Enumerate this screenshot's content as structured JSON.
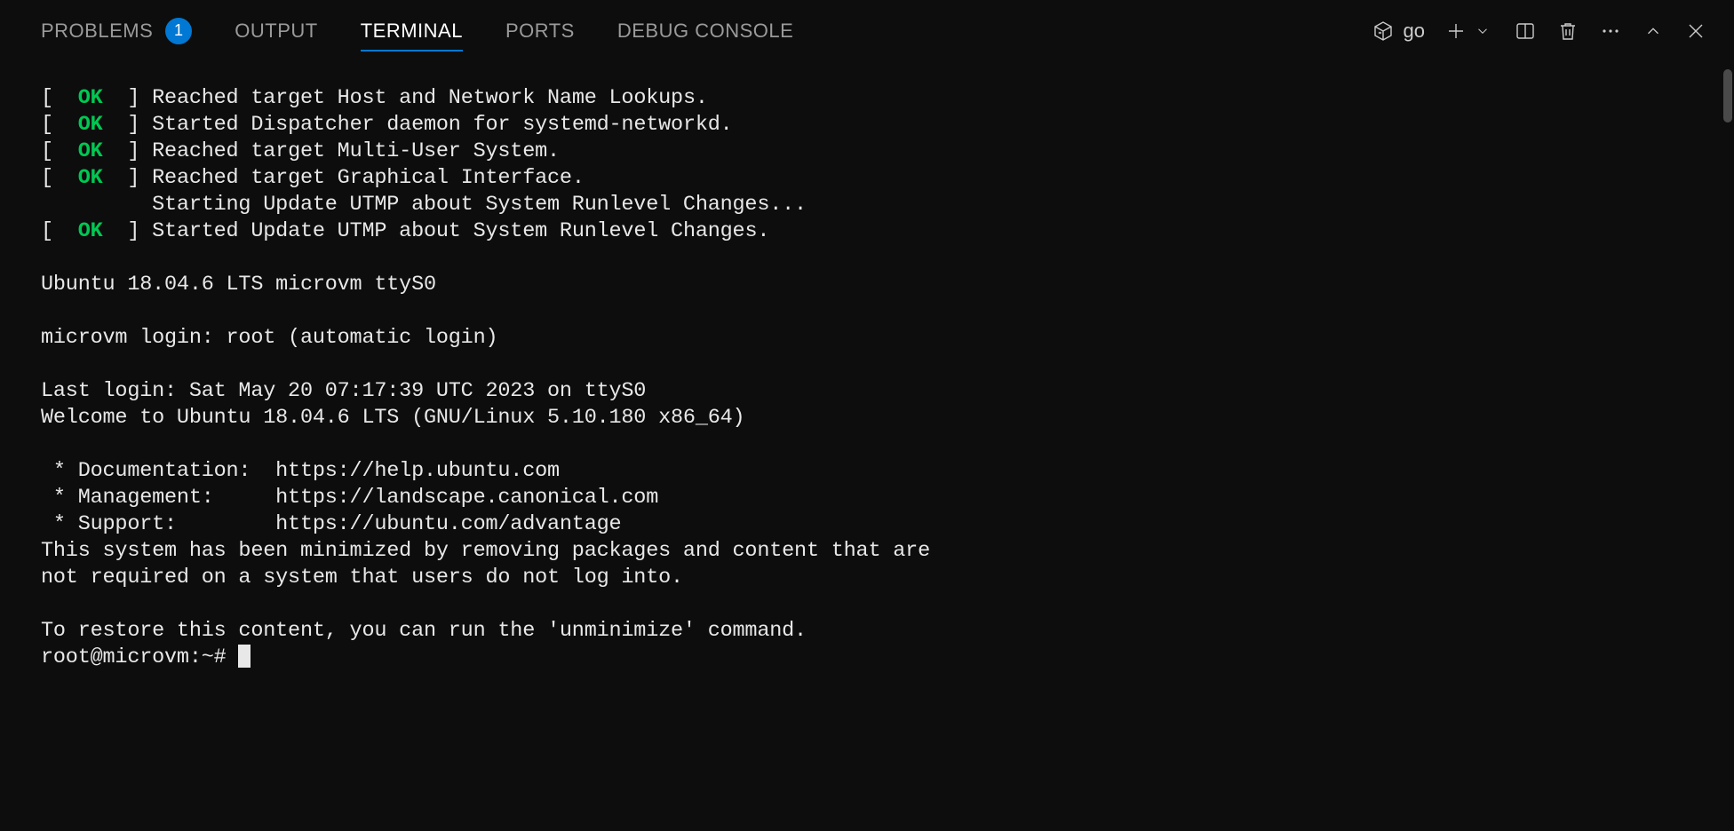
{
  "tabs": {
    "problems": {
      "label": "PROBLEMS",
      "badge": "1"
    },
    "output": {
      "label": "OUTPUT"
    },
    "terminal": {
      "label": "TERMINAL"
    },
    "ports": {
      "label": "PORTS"
    },
    "debug_console": {
      "label": "DEBUG CONSOLE"
    }
  },
  "toolbar": {
    "profile_label": "go"
  },
  "terminal": {
    "boot_lines": [
      {
        "status": "OK",
        "msg": "Reached target Host and Network Name Lookups."
      },
      {
        "status": "OK",
        "msg": "Started Dispatcher daemon for systemd-networkd."
      },
      {
        "status": "OK",
        "msg": "Reached target Multi-User System."
      },
      {
        "status": "OK",
        "msg": "Reached target Graphical Interface."
      },
      {
        "status": "",
        "msg": "Starting Update UTMP about System Runlevel Changes..."
      },
      {
        "status": "OK",
        "msg": "Started Update UTMP about System Runlevel Changes."
      }
    ],
    "banner": "Ubuntu 18.04.6 LTS microvm ttyS0",
    "login_line": "microvm login: root (automatic login)",
    "last_login": "Last login: Sat May 20 07:17:39 UTC 2023 on ttyS0",
    "welcome": "Welcome to Ubuntu 18.04.6 LTS (GNU/Linux 5.10.180 x86_64)",
    "links": {
      "doc": " * Documentation:  https://help.ubuntu.com",
      "mgmt": " * Management:     https://landscape.canonical.com",
      "support": " * Support:        https://ubuntu.com/advantage"
    },
    "minimized1": "This system has been minimized by removing packages and content that are",
    "minimized2": "not required on a system that users do not log into.",
    "restore": "To restore this content, you can run the 'unminimize' command.",
    "prompt": "root@microvm:~# "
  }
}
